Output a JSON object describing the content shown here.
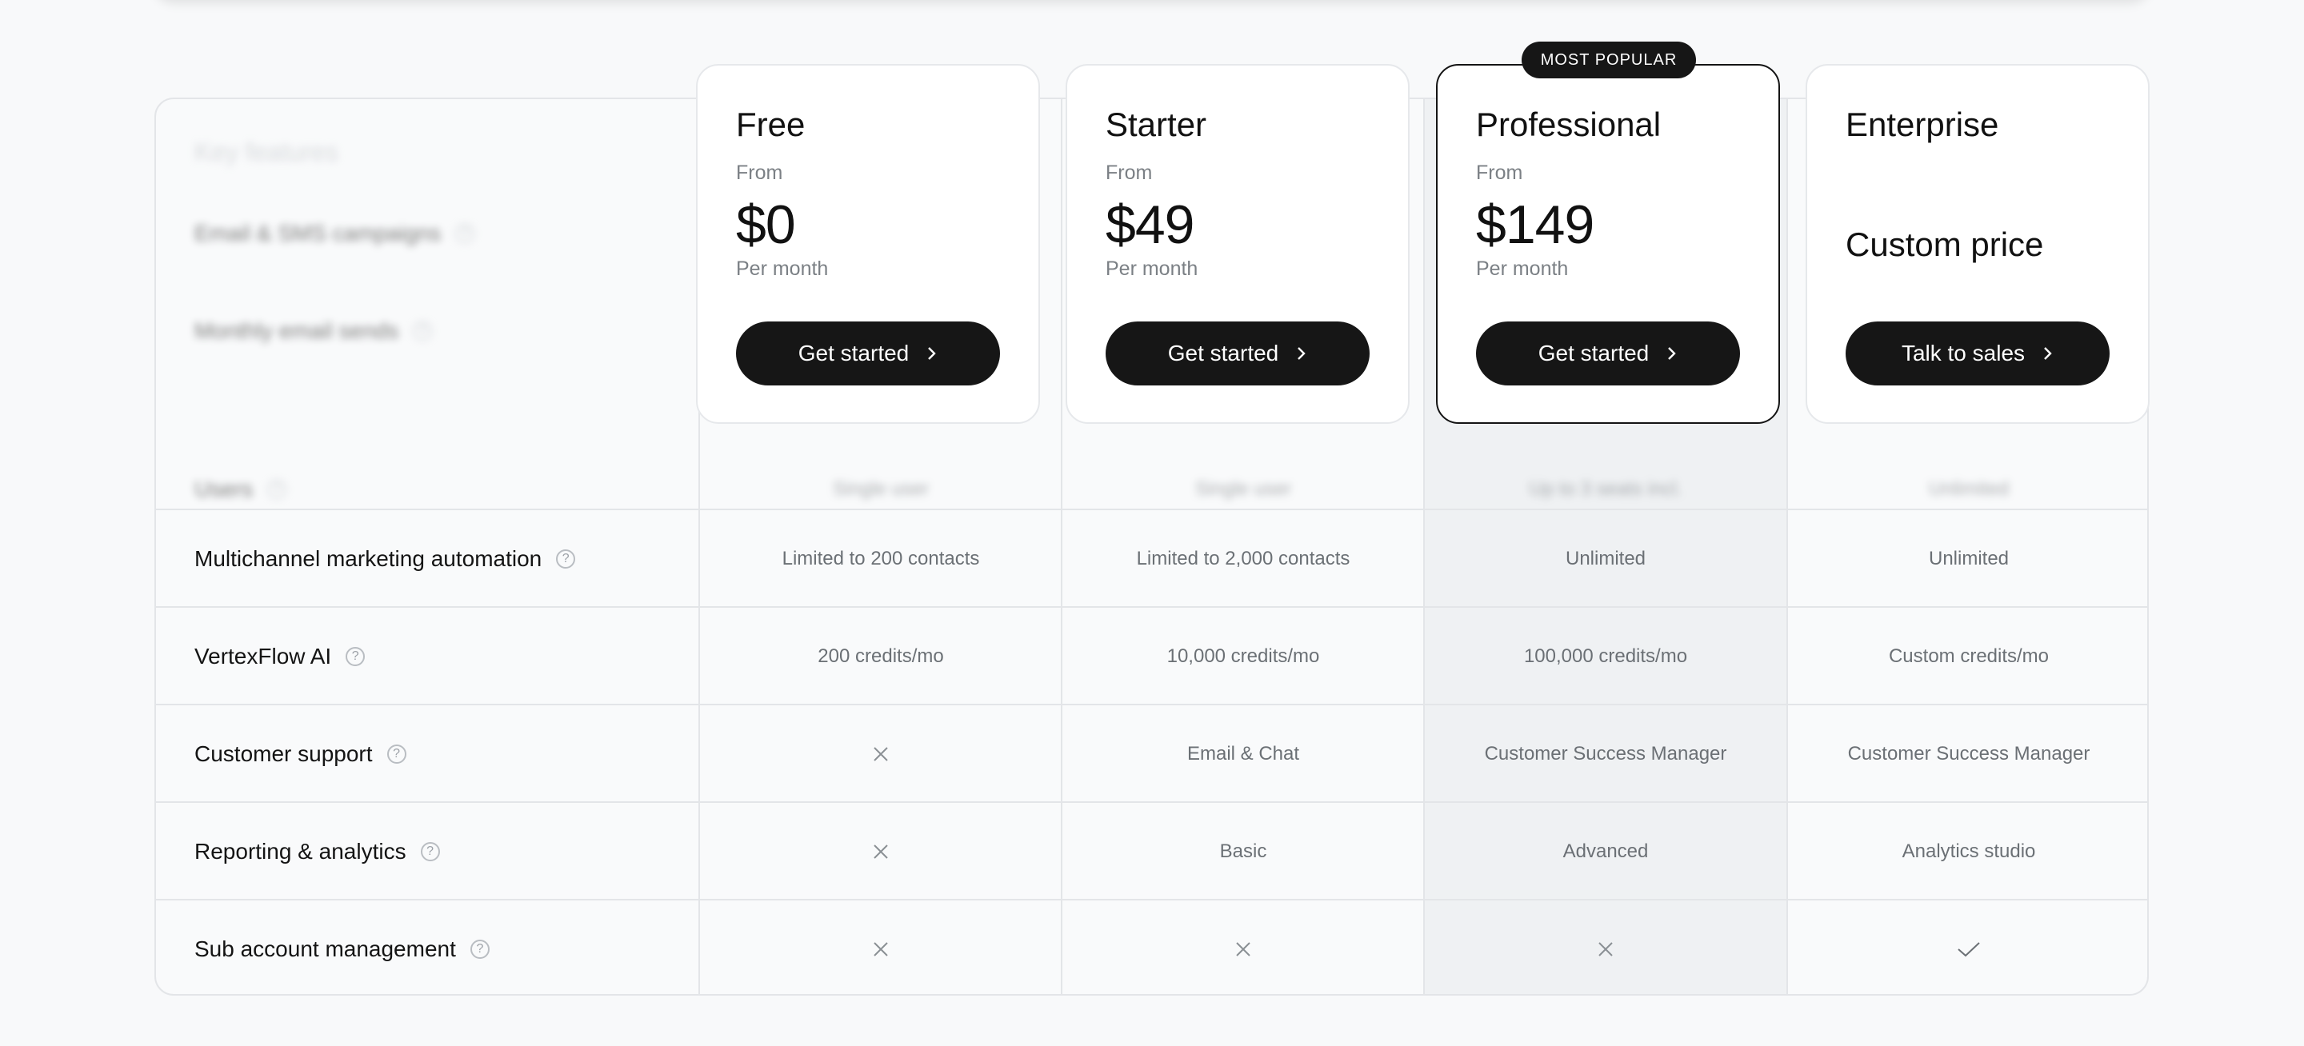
{
  "plans": [
    {
      "name": "Free",
      "from": "From",
      "price": "$0",
      "period": "Per month",
      "cta": "Get started"
    },
    {
      "name": "Starter",
      "from": "From",
      "price": "$49",
      "period": "Per month",
      "cta": "Get started"
    },
    {
      "name": "Professional",
      "from": "From",
      "price": "$149",
      "period": "Per month",
      "cta": "Get started"
    },
    {
      "name": "Enterprise",
      "custom_price": "Custom price",
      "cta": "Talk to sales"
    }
  ],
  "badge": "MOST POPULAR",
  "table": {
    "header": "Key features",
    "hidden_rows": [
      {
        "feature": "Email & SMS campaigns"
      },
      {
        "feature": "Monthly email sends"
      },
      {
        "feature": "Users",
        "values": [
          "Single user",
          "Single user",
          "Up to 3 seats incl.",
          "Unlimited"
        ]
      }
    ],
    "rows": [
      {
        "feature": "Multichannel marketing automation",
        "values": [
          "Limited to 200 contacts",
          "Limited to 2,000 contacts",
          "Unlimited",
          "Unlimited"
        ]
      },
      {
        "feature": "VertexFlow AI",
        "values": [
          "200 credits/mo",
          "10,000 credits/mo",
          "100,000 credits/mo",
          "Custom credits/mo"
        ]
      },
      {
        "feature": "Customer support",
        "values": [
          "",
          "Email & Chat",
          "Customer Success Manager",
          "Customer Success Manager"
        ],
        "marks": [
          "x",
          "",
          "",
          ""
        ]
      },
      {
        "feature": "Reporting & analytics",
        "values": [
          "",
          "Basic",
          "Advanced",
          "Analytics studio"
        ],
        "marks": [
          "x",
          "",
          "",
          ""
        ]
      },
      {
        "feature": "Sub account management",
        "values": [
          "",
          "",
          "",
          ""
        ],
        "marks": [
          "x",
          "x",
          "x",
          "check"
        ]
      }
    ]
  },
  "icons": {
    "help": "question-circle-icon",
    "chevron": "chevron-right-icon",
    "unavailable": "x-icon",
    "available": "check-icon",
    "help_glyph": "?"
  },
  "colors": {
    "primary": "#161616",
    "highlight_column": "#eff1f3",
    "border": "#e3e5e8"
  }
}
